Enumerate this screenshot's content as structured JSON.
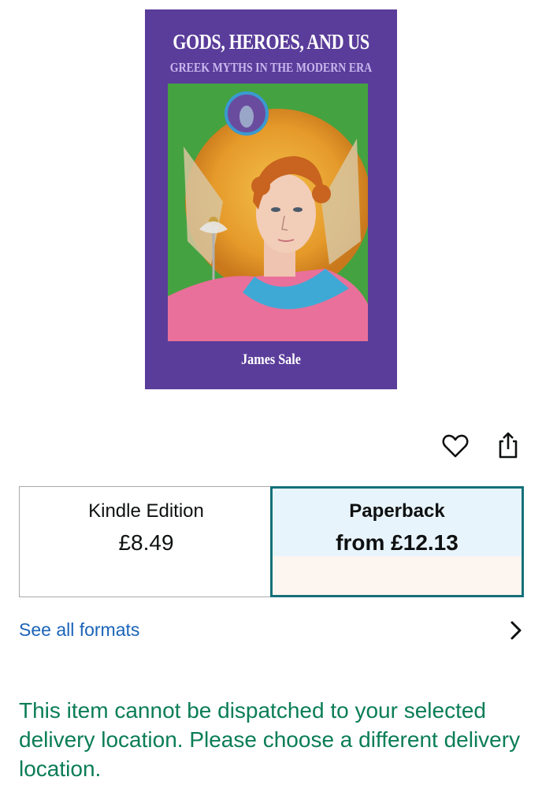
{
  "book": {
    "title": "GODS, HEROES, AND US",
    "subtitle": "GREEK MYTHS IN THE MODERN ERA",
    "author": "James Sale"
  },
  "actions": {
    "wishlist_icon": "heart-icon",
    "share_icon": "share-icon"
  },
  "formats": [
    {
      "name": "Kindle Edition",
      "price": "£8.49",
      "selected": false
    },
    {
      "name": "Paperback",
      "price": "from £12.13",
      "selected": true
    }
  ],
  "see_all_formats": "See all formats",
  "dispatch_message": "This item cannot be dispatched to your selected delivery location. Please choose a different delivery location.",
  "colors": {
    "cover_background": "#5a3d9a",
    "selected_border": "#15707a",
    "link": "#1a64b8",
    "message": "#0a7d56"
  }
}
